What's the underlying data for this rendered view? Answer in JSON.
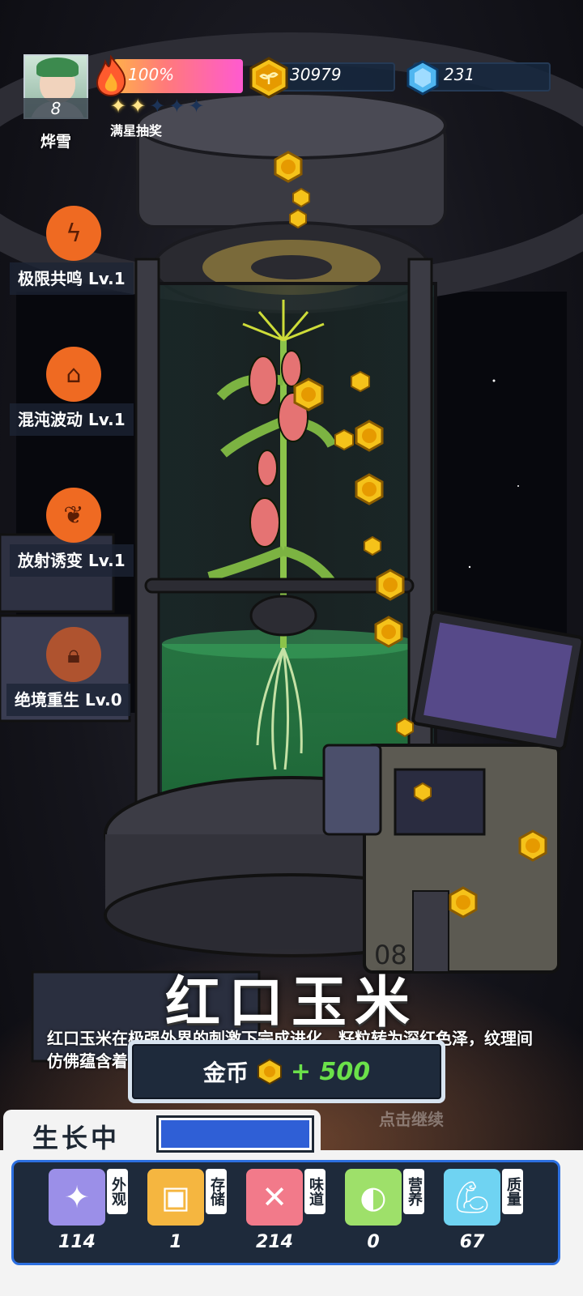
{
  "player": {
    "name": "烨雪",
    "level": "8"
  },
  "energy": {
    "percent_text": "100%",
    "stars_filled": 2,
    "stars_total": 5,
    "stars_label": "满星抽奖"
  },
  "currency": {
    "gold": "30979",
    "gems": "231"
  },
  "skills": [
    {
      "label": "极限共鸣 Lv.1",
      "icon": "lightning-sprout-icon"
    },
    {
      "label": "混沌波动 Lv.1",
      "icon": "plant-dome-icon"
    },
    {
      "label": "放射诱变 Lv.1",
      "icon": "sprout-box-icon"
    },
    {
      "label": "绝境重生 Lv.0",
      "icon": "lock-icon"
    }
  ],
  "plant": {
    "name": "红口玉米",
    "description": "红口玉米在极强外界的刺激下完成进化，籽粒转为深红色泽，纹理间仿佛蕴含着来自宇宙深处的力量。",
    "tap_to_continue": "点击继续"
  },
  "reward": {
    "label": "金币",
    "amount": "+ 500"
  },
  "growth": {
    "label": "生长中",
    "progress": 1.0
  },
  "stats": [
    {
      "tag": "外观",
      "value": "114",
      "icon": "sparkle-icon",
      "color": "#9b8fe8"
    },
    {
      "tag": "存储",
      "value": "1",
      "icon": "box-icon",
      "color": "#f5b640"
    },
    {
      "tag": "味道",
      "value": "214",
      "icon": "fork-knife-icon",
      "color": "#f27a8a"
    },
    {
      "tag": "营养",
      "value": "0",
      "icon": "lemon-icon",
      "color": "#9ee06a"
    },
    {
      "tag": "质量",
      "value": "67",
      "icon": "muscle-icon",
      "color": "#6fd3f2"
    }
  ],
  "colors": {
    "accent_blue": "#2c6fe0",
    "reward_green": "#6be14a",
    "skill_orange": "#ef6a22"
  }
}
